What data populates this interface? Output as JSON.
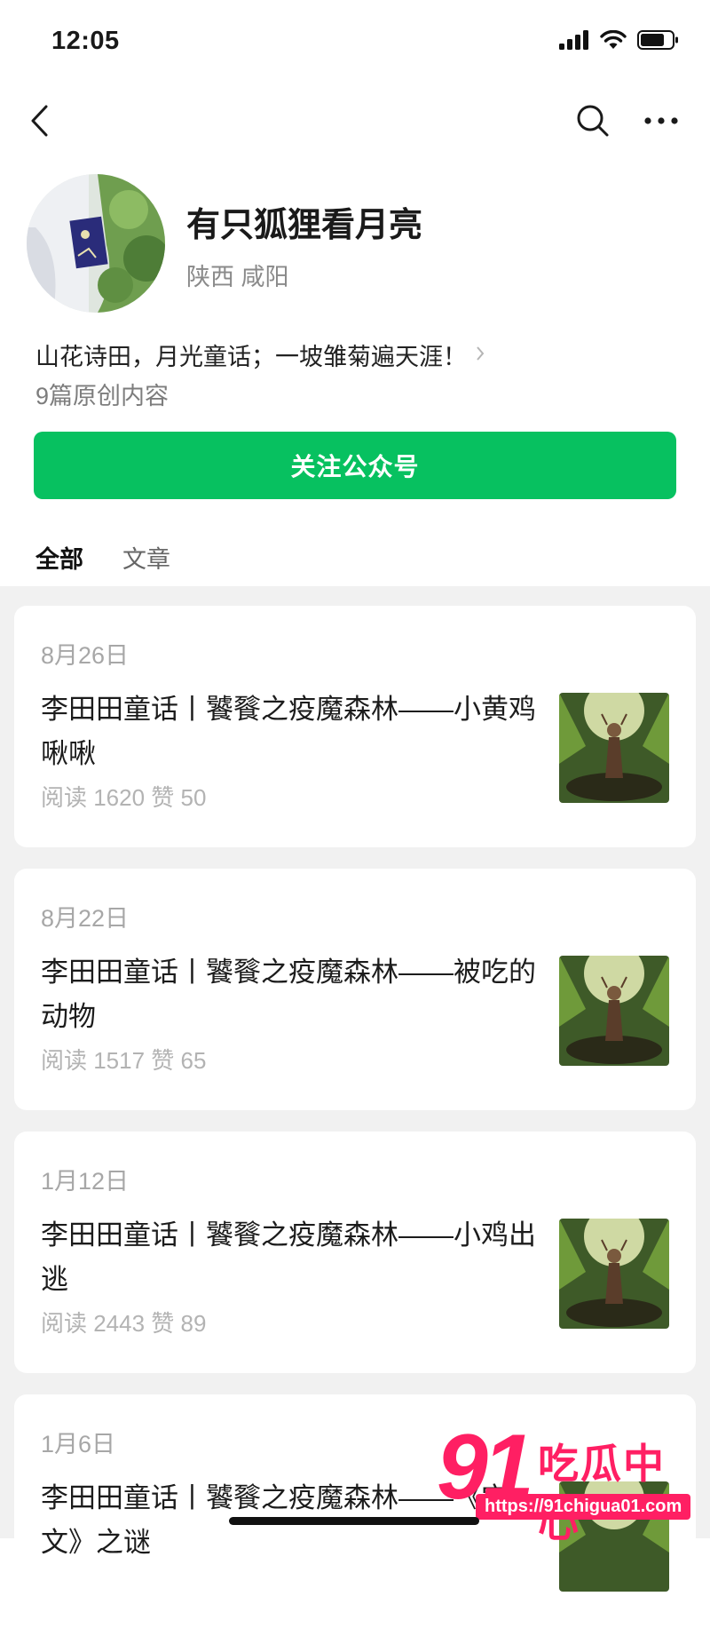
{
  "status_bar": {
    "time": "12:05"
  },
  "profile": {
    "name": "有只狐狸看月亮",
    "location": "陕西 咸阳",
    "bio": "山花诗田，月光童话；一坡雏菊遍天涯！",
    "original_count": "9篇原创内容",
    "follow_label": "关注公众号"
  },
  "tabs": [
    {
      "label": "全部",
      "active": true
    },
    {
      "label": "文章",
      "active": false
    }
  ],
  "articles": [
    {
      "date": "8月26日",
      "title": "李田田童话丨饕餮之疫魔森林——小黄鸡啾啾",
      "stats": "阅读 1620  赞 50"
    },
    {
      "date": "8月22日",
      "title": "李田田童话丨饕餮之疫魔森林——被吃的动物",
      "stats": "阅读 1517  赞 65"
    },
    {
      "date": "1月12日",
      "title": "李田田童话丨饕餮之疫魔森林——小鸡出逃",
      "stats": "阅读 2443  赞 89"
    },
    {
      "date": "1月6日",
      "title": "李田田童话丨饕餮之疫魔森林——《宝文》之谜",
      "stats": ""
    }
  ],
  "watermark": {
    "brand_number": "91",
    "brand_text": "吃瓜中心",
    "url": "https://91chigua01.com"
  },
  "colors": {
    "accent": "#07c160",
    "watermark": "#ff1f63",
    "list_bg": "#f1f1f1"
  },
  "icons": [
    "signal-icon",
    "wifi-icon",
    "battery-icon",
    "back-icon",
    "search-icon",
    "more-icon"
  ]
}
